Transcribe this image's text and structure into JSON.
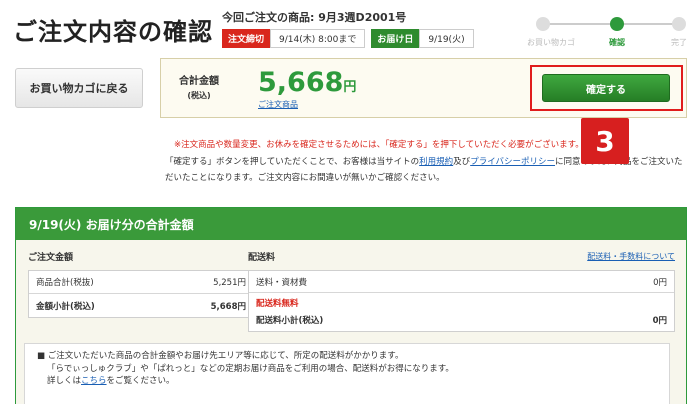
{
  "page": {
    "title": "ご注文内容の確認"
  },
  "order_info": {
    "product_label": "今回ご注文の商品:",
    "product_value": "9月3週D2001号",
    "deadline_tag": "注文締切",
    "deadline_value": "9/14(木) 8:00まで",
    "delivery_tag": "お届け日",
    "delivery_value": "9/19(火)"
  },
  "steps": [
    {
      "label": "お買い物カゴ",
      "active": false
    },
    {
      "label": "確認",
      "active": true
    },
    {
      "label": "完了",
      "active": false
    }
  ],
  "back_button": "お買い物カゴに戻る",
  "total": {
    "label": "合計金額",
    "sub": "(税込)",
    "amount": "5,668",
    "currency": "円",
    "link": "ご注文商品"
  },
  "confirm_button": "確定する",
  "notice": {
    "red": "※注文商品や数量変更、お休みを確定させるためには、「確定する」を押下していただく必要がございます。",
    "body_1": "「確定する」ボタンを押していただくことで、お客様は当サイトの",
    "link_terms": "利用規約",
    "body_2": "及び",
    "link_privacy": "プライバシーポリシー",
    "body_3": "に同意のうえ、商品をご注文いただいたことになります。ご注文内容にお間違いが無いかご確認ください。"
  },
  "badge": "3",
  "delivery": {
    "header": "9/19(火) お届け分の合計金額",
    "order_total_head": "ご注文金額",
    "order_rows": [
      {
        "label": "商品合計(税抜)",
        "value": "5,251円",
        "bold": false
      },
      {
        "label": "金額小計(税込)",
        "value": "5,668円",
        "bold": true
      }
    ],
    "shipping_head": "配送料",
    "shipping_link": "配送料・手数料について",
    "shipping_row_label": "送料・資材費",
    "shipping_row_value": "0円",
    "shipping_free": "配送料無料",
    "shipping_subtotal_label": "配送料小計(税込)",
    "shipping_subtotal_value": "0円"
  },
  "note": {
    "line1": "■ ご注文いただいた商品の合計金額やお届け先エリア等に応じて、所定の配送料がかかります。",
    "line2": "「らでぃっしゅクラブ」や「ぱれっと」などの定期お届け商品をご利用の場合、配送料がお得になります。",
    "line3_pre": "詳しくは",
    "line3_link": "こちら",
    "line3_post": "をご覧ください。"
  },
  "colors": {
    "brand_green": "#2e9a3c",
    "alert_red": "#d9261c",
    "link_blue": "#1a5fb4"
  }
}
